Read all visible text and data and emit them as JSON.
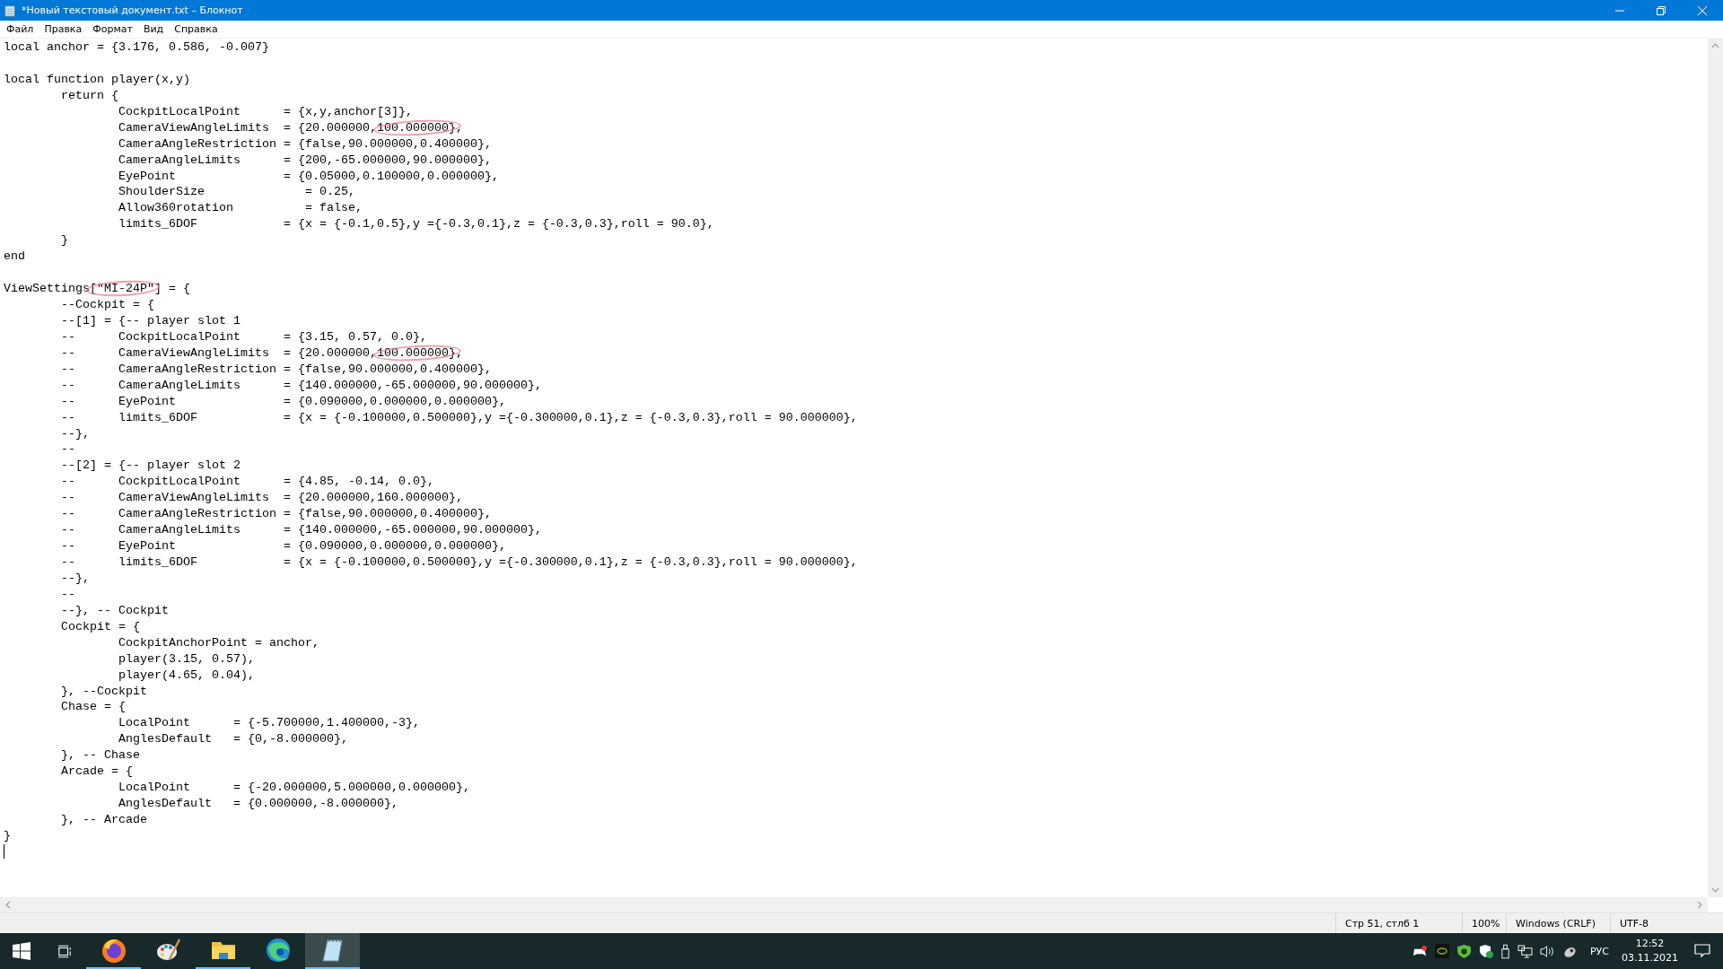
{
  "window": {
    "title": "*Новый текстовый документ.txt – Блокнот"
  },
  "menu": [
    "Файл",
    "Правка",
    "Формат",
    "Вид",
    "Справка"
  ],
  "editor": {
    "lines": [
      {
        "kind": "code",
        "parts": [
          {
            "text": "local anchor = {3.176, 0.586, -0.007}",
            "circled": false
          }
        ]
      },
      {
        "kind": "blank"
      },
      {
        "kind": "code",
        "parts": [
          {
            "text": "local function player(x,y)",
            "circled": false
          }
        ]
      },
      {
        "kind": "code",
        "parts": [
          {
            "text": "\treturn {",
            "circled": false
          }
        ]
      },
      {
        "kind": "code",
        "parts": [
          {
            "text": "\t\tCockpitLocalPoint      = {x,y,anchor[3]},",
            "circled": false
          }
        ]
      },
      {
        "kind": "code",
        "parts": [
          {
            "text": "\t\tCameraViewAngleLimits  = {20.000000,",
            "circled": false
          },
          {
            "text": "100.000000}",
            "circled": true
          },
          {
            "text": ",",
            "circled": false
          }
        ]
      },
      {
        "kind": "code",
        "parts": [
          {
            "text": "\t\tCameraAngleRestriction = {false,90.000000,0.400000},",
            "circled": false
          }
        ]
      },
      {
        "kind": "code",
        "parts": [
          {
            "text": "\t\tCameraAngleLimits      = {200,-65.000000,90.000000},",
            "circled": false
          }
        ]
      },
      {
        "kind": "code",
        "parts": [
          {
            "text": "\t\tEyePoint               = {0.05000,0.100000,0.000000},",
            "circled": false
          }
        ]
      },
      {
        "kind": "code",
        "parts": [
          {
            "text": "\t\tShoulderSize              = 0.25,",
            "circled": false
          }
        ]
      },
      {
        "kind": "code",
        "parts": [
          {
            "text": "\t\tAllow360rotation          = false,",
            "circled": false
          }
        ]
      },
      {
        "kind": "code",
        "parts": [
          {
            "text": "\t\tlimits_6DOF            = {x = {-0.1,0.5},y ={-0.3,0.1},z = {-0.3,0.3},roll = 90.0},",
            "circled": false
          }
        ]
      },
      {
        "kind": "code",
        "parts": [
          {
            "text": "\t}",
            "circled": false
          }
        ]
      },
      {
        "kind": "code",
        "parts": [
          {
            "text": "end",
            "circled": false
          }
        ]
      },
      {
        "kind": "blank"
      },
      {
        "kind": "code",
        "parts": [
          {
            "text": "ViewSettings",
            "circled": false
          },
          {
            "text": "[\"MI-24P\"",
            "circled": true
          },
          {
            "text": "] = {",
            "circled": false
          }
        ]
      },
      {
        "kind": "code",
        "parts": [
          {
            "text": "\t--Cockpit = {",
            "circled": false
          }
        ]
      },
      {
        "kind": "code",
        "parts": [
          {
            "text": "\t--[1] = {-- player slot 1",
            "circled": false
          }
        ]
      },
      {
        "kind": "code",
        "parts": [
          {
            "text": "\t--\tCockpitLocalPoint      = {3.15, 0.57, 0.0},",
            "circled": false
          }
        ]
      },
      {
        "kind": "code",
        "parts": [
          {
            "text": "\t--\tCameraViewAngleLimits  = {20.000000,",
            "circled": false
          },
          {
            "text": "100.000000}",
            "circled": true
          },
          {
            "text": ",",
            "circled": false
          }
        ]
      },
      {
        "kind": "code",
        "parts": [
          {
            "text": "\t--\tCameraAngleRestriction = {false,90.000000,0.400000},",
            "circled": false
          }
        ]
      },
      {
        "kind": "code",
        "parts": [
          {
            "text": "\t--\tCameraAngleLimits      = {140.000000,-65.000000,90.000000},",
            "circled": false
          }
        ]
      },
      {
        "kind": "code",
        "parts": [
          {
            "text": "\t--\tEyePoint               = {0.090000,0.000000,0.000000},",
            "circled": false
          }
        ]
      },
      {
        "kind": "code",
        "parts": [
          {
            "text": "\t--\tlimits_6DOF            = {x = {-0.100000,0.500000},y ={-0.300000,0.1},z = {-0.3,0.3},roll = 90.000000},",
            "circled": false
          }
        ]
      },
      {
        "kind": "code",
        "parts": [
          {
            "text": "\t--},",
            "circled": false
          }
        ]
      },
      {
        "kind": "code",
        "parts": [
          {
            "text": "\t--",
            "circled": false
          }
        ]
      },
      {
        "kind": "code",
        "parts": [
          {
            "text": "\t--[2] = {-- player slot 2",
            "circled": false
          }
        ]
      },
      {
        "kind": "code",
        "parts": [
          {
            "text": "\t--\tCockpitLocalPoint      = {4.85, -0.14, 0.0},",
            "circled": false
          }
        ]
      },
      {
        "kind": "code",
        "parts": [
          {
            "text": "\t--\tCameraViewAngleLimits  = {20.000000,160.000000},",
            "circled": false
          }
        ]
      },
      {
        "kind": "code",
        "parts": [
          {
            "text": "\t--\tCameraAngleRestriction = {false,90.000000,0.400000},",
            "circled": false
          }
        ]
      },
      {
        "kind": "code",
        "parts": [
          {
            "text": "\t--\tCameraAngleLimits      = {140.000000,-65.000000,90.000000},",
            "circled": false
          }
        ]
      },
      {
        "kind": "code",
        "parts": [
          {
            "text": "\t--\tEyePoint               = {0.090000,0.000000,0.000000},",
            "circled": false
          }
        ]
      },
      {
        "kind": "code",
        "parts": [
          {
            "text": "\t--\tlimits_6DOF            = {x = {-0.100000,0.500000},y ={-0.300000,0.1},z = {-0.3,0.3},roll = 90.000000},",
            "circled": false
          }
        ]
      },
      {
        "kind": "code",
        "parts": [
          {
            "text": "\t--},",
            "circled": false
          }
        ]
      },
      {
        "kind": "code",
        "parts": [
          {
            "text": "\t--",
            "circled": false
          }
        ]
      },
      {
        "kind": "code",
        "parts": [
          {
            "text": "\t--}, -- Cockpit",
            "circled": false
          }
        ]
      },
      {
        "kind": "code",
        "parts": [
          {
            "text": "\tCockpit = {",
            "circled": false
          }
        ]
      },
      {
        "kind": "code",
        "parts": [
          {
            "text": "\t\tCockpitAnchorPoint = anchor,",
            "circled": false
          }
        ]
      },
      {
        "kind": "code",
        "parts": [
          {
            "text": "\t\tplayer(3.15, 0.57),",
            "circled": false
          }
        ]
      },
      {
        "kind": "code",
        "parts": [
          {
            "text": "\t\tplayer(4.65, 0.04),",
            "circled": false
          }
        ]
      },
      {
        "kind": "code",
        "parts": [
          {
            "text": "\t}, --Cockpit",
            "circled": false
          }
        ]
      },
      {
        "kind": "code",
        "parts": [
          {
            "text": "\tChase = {",
            "circled": false
          }
        ]
      },
      {
        "kind": "code",
        "parts": [
          {
            "text": "\t\tLocalPoint      = {-5.700000,1.400000,-3},",
            "circled": false
          }
        ]
      },
      {
        "kind": "code",
        "parts": [
          {
            "text": "\t\tAnglesDefault   = {0,-8.000000},",
            "circled": false
          }
        ]
      },
      {
        "kind": "code",
        "parts": [
          {
            "text": "\t}, -- Chase",
            "circled": false
          }
        ]
      },
      {
        "kind": "code",
        "parts": [
          {
            "text": "\tArcade = {",
            "circled": false
          }
        ]
      },
      {
        "kind": "code",
        "parts": [
          {
            "text": "\t\tLocalPoint      = {-20.000000,5.000000,0.000000},",
            "circled": false
          }
        ]
      },
      {
        "kind": "code",
        "parts": [
          {
            "text": "\t\tAnglesDefault   = {0.000000,-8.000000},",
            "circled": false
          }
        ]
      },
      {
        "kind": "code",
        "parts": [
          {
            "text": "\t}, -- Arcade",
            "circled": false
          }
        ]
      },
      {
        "kind": "code",
        "parts": [
          {
            "text": "}",
            "circled": false
          }
        ]
      },
      {
        "kind": "caret"
      }
    ]
  },
  "status_bar": {
    "position": "Стр 51, стлб 1",
    "zoom": "100%",
    "line_ending": "Windows (CRLF)",
    "encoding": "UTF-8"
  },
  "taskbar": {
    "apps": [
      {
        "kind": "firefox",
        "running": true,
        "selected": false
      },
      {
        "kind": "paint",
        "running": false,
        "selected": false
      },
      {
        "kind": "explorer",
        "running": true,
        "selected": false
      },
      {
        "kind": "edge",
        "running": false,
        "selected": false
      },
      {
        "kind": "notepad",
        "running": true,
        "selected": true
      }
    ],
    "language": "РУС",
    "time": "12:52",
    "date": "03.11.2021"
  }
}
